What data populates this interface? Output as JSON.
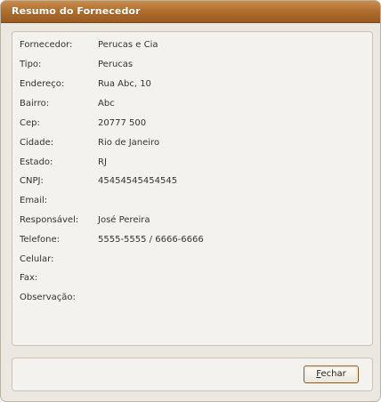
{
  "window": {
    "title": "Resumo do Fornecedor"
  },
  "fields": [
    {
      "label": "Fornecedor:",
      "value": "Perucas e Cia"
    },
    {
      "label": "Tipo:",
      "value": "Perucas"
    },
    {
      "label": "Endereço:",
      "value": "Rua Abc, 10"
    },
    {
      "label": "Bairro:",
      "value": "Abc"
    },
    {
      "label": "Cep:",
      "value": "20777 500"
    },
    {
      "label": "Cidade:",
      "value": "Rio de Janeiro"
    },
    {
      "label": "Estado:",
      "value": "RJ"
    },
    {
      "label": "CNPJ:",
      "value": "45454545454545"
    },
    {
      "label": "Email:",
      "value": ""
    },
    {
      "label": "Responsável:",
      "value": "José Pereira"
    },
    {
      "label": "Telefone:",
      "value": "5555-5555 / 6666-6666"
    },
    {
      "label": "Celular:",
      "value": ""
    },
    {
      "label": "Fax:",
      "value": ""
    },
    {
      "label": "Observação:",
      "value": ""
    }
  ],
  "buttons": {
    "close_mnemonic": "F",
    "close_rest": "echar"
  },
  "colors": {
    "titlebar": "#b06f2f",
    "panel": "#f4f2ee",
    "window_bg": "#ebe8e1",
    "button_border": "#8d5a26"
  }
}
